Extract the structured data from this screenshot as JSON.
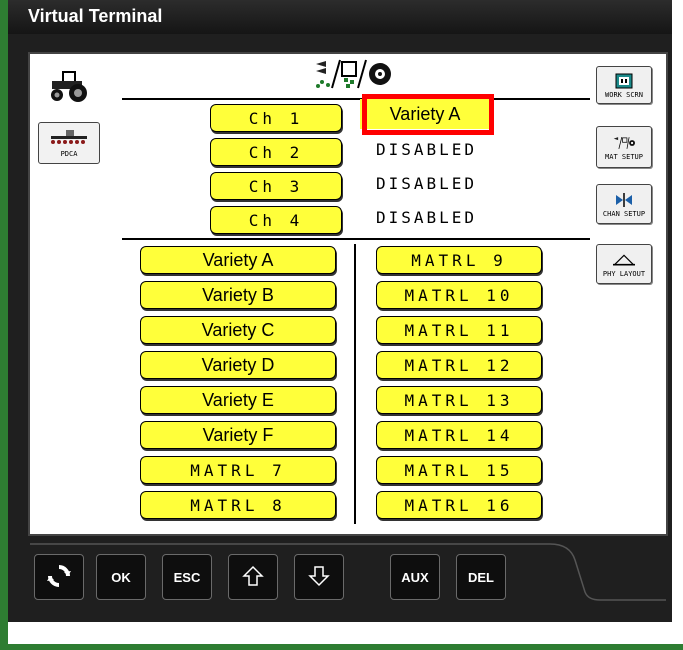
{
  "window": {
    "title": "Virtual Terminal"
  },
  "left_panel": {
    "tractor_button": {
      "icon": "tractor-icon"
    },
    "pdca_button": {
      "label": "PDCA",
      "icon": "planter-icon"
    }
  },
  "header": {
    "icon": "material-setup-icon"
  },
  "channels": [
    {
      "label": "Ch 1",
      "status": "Variety A",
      "highlighted": true
    },
    {
      "label": "Ch 2",
      "status": "DISABLED"
    },
    {
      "label": "Ch 3",
      "status": "DISABLED"
    },
    {
      "label": "Ch 4",
      "status": "DISABLED"
    }
  ],
  "materials_left": [
    "Variety A",
    "Variety B",
    "Variety C",
    "Variety D",
    "Variety E",
    "Variety F",
    "MATRL 7",
    "MATRL 8"
  ],
  "materials_right": [
    "MATRL 9",
    "MATRL 10",
    "MATRL 11",
    "MATRL 12",
    "MATRL 13",
    "MATRL 14",
    "MATRL 15",
    "MATRL 16"
  ],
  "right_panel": [
    {
      "label": "WORK SCRN",
      "icon": "work-screen-icon"
    },
    {
      "label": "MAT SETUP",
      "icon": "material-setup-icon"
    },
    {
      "label": "CHAN SETUP",
      "icon": "channel-setup-icon"
    },
    {
      "label": "PHY LAYOUT",
      "icon": "physical-layout-icon"
    }
  ],
  "softkeys": {
    "refresh": {
      "icon": "refresh-icon"
    },
    "ok": "OK",
    "esc": "ESC",
    "up": {
      "icon": "arrow-up-icon"
    },
    "down": {
      "icon": "arrow-down-icon"
    },
    "aux": "AUX",
    "del": "DEL"
  },
  "colors": {
    "button_yellow": "#ffff3a",
    "highlight_red": "#ff0000",
    "frame_dark": "#1f1f1f",
    "accent_green": "#2e7d32"
  }
}
